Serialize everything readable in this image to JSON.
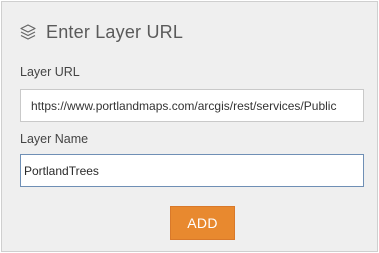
{
  "header": {
    "icon": "layers-icon",
    "title": "Enter Layer URL"
  },
  "form": {
    "layer_url": {
      "label": "Layer URL",
      "value": "https://www.portlandmaps.com/arcgis/rest/services/Public"
    },
    "layer_name": {
      "label": "Layer Name",
      "value": "PortlandTrees"
    },
    "add_label": "ADD"
  },
  "colors": {
    "panel_background": "#efefef",
    "accent_button": "#e8892f",
    "focused_border": "#6f8fb5",
    "title_text": "#5a5a5a"
  }
}
